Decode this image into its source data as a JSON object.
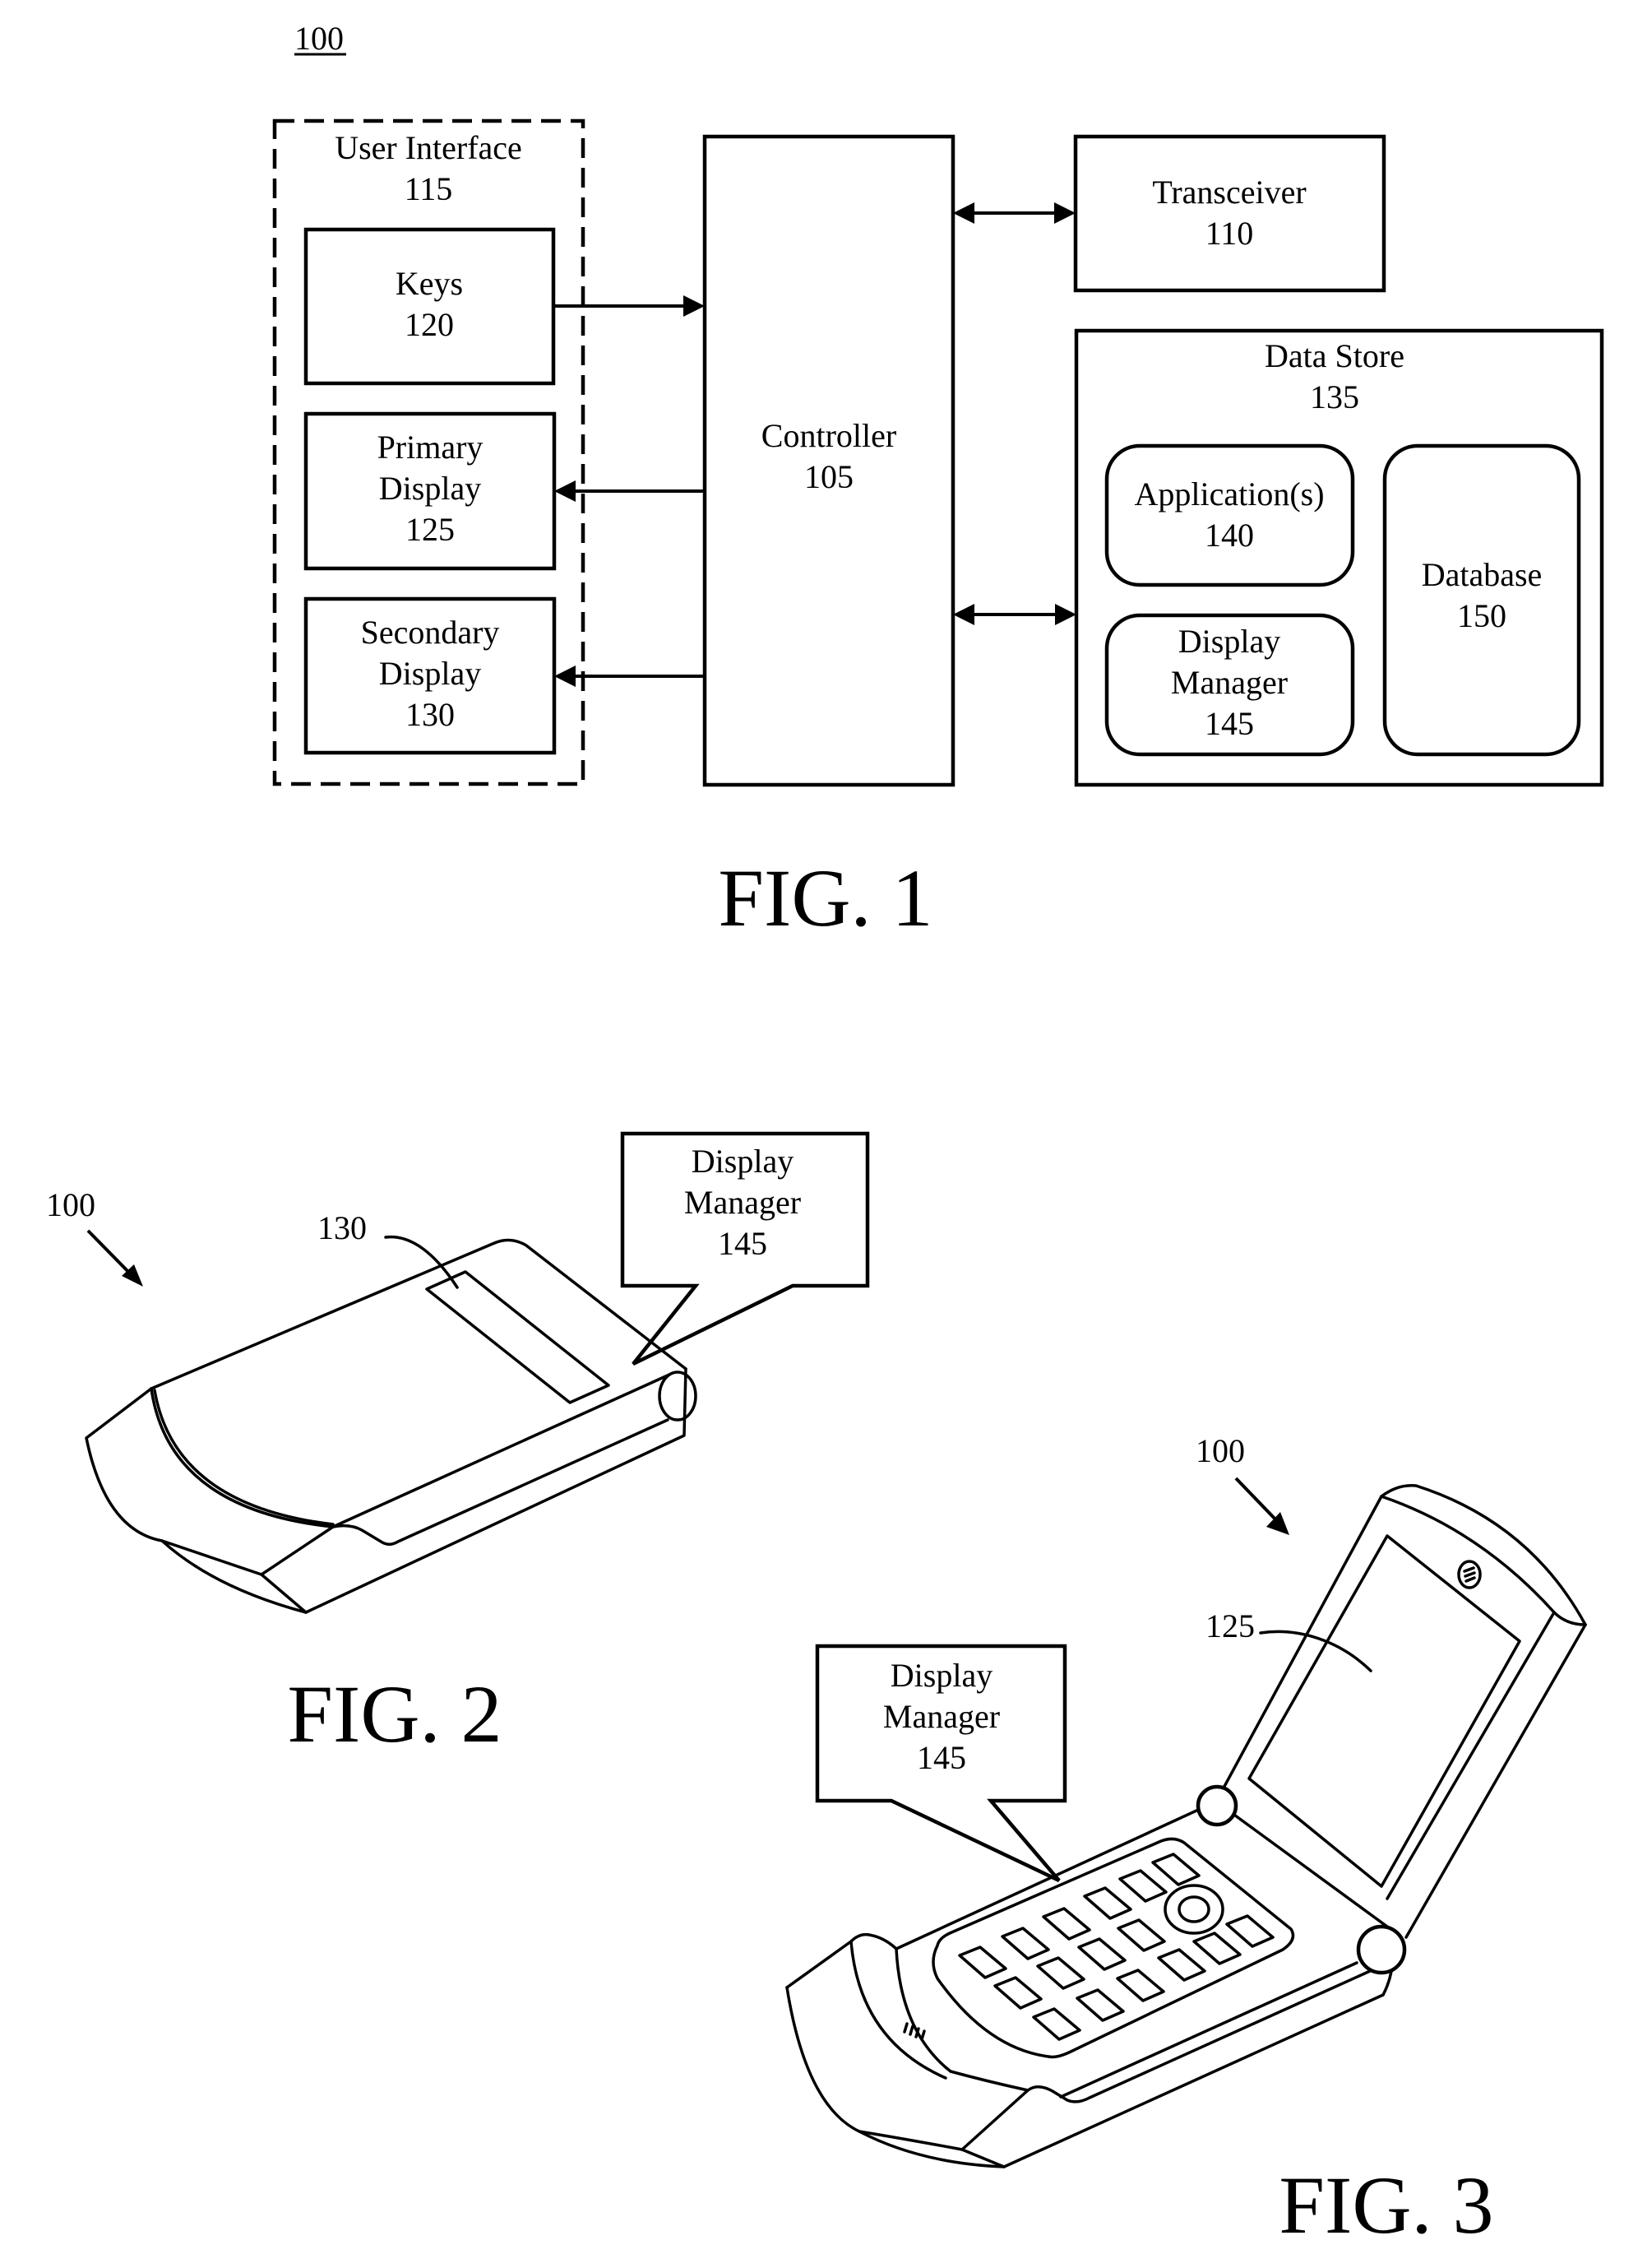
{
  "figure_ref": "100",
  "fig1": {
    "caption": "FIG. 1",
    "user_interface": {
      "title": "User Interface",
      "number": "115"
    },
    "keys": {
      "lines": [
        "Keys",
        "120"
      ]
    },
    "primary_display": {
      "lines": [
        "Primary",
        "Display",
        "125"
      ]
    },
    "secondary_display": {
      "lines": [
        "Secondary",
        "Display",
        "130"
      ]
    },
    "controller": {
      "lines": [
        "Controller",
        "105"
      ]
    },
    "transceiver": {
      "lines": [
        "Transceiver",
        "110"
      ]
    },
    "data_store": {
      "title": "Data Store",
      "number": "135"
    },
    "applications": {
      "lines": [
        "Application(s)",
        "140"
      ]
    },
    "display_manager": {
      "lines": [
        "Display",
        "Manager",
        "145"
      ]
    },
    "database": {
      "lines": [
        "Database",
        "150"
      ]
    }
  },
  "fig2": {
    "caption": "FIG. 2",
    "device_ref": "100",
    "secondary_display_ref": "130",
    "callout": {
      "lines": [
        "Display",
        "Manager",
        "145"
      ]
    }
  },
  "fig3": {
    "caption": "FIG. 3",
    "device_ref": "100",
    "primary_display_ref": "125",
    "callout": {
      "lines": [
        "Display",
        "Manager",
        "145"
      ]
    }
  }
}
